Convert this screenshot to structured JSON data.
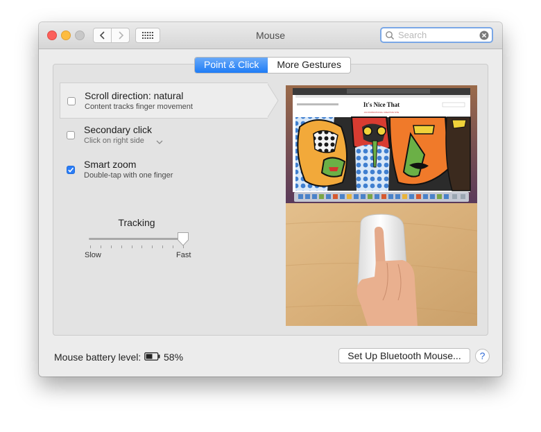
{
  "window": {
    "title": "Mouse"
  },
  "toolbar": {
    "search_placeholder": "Search"
  },
  "tabs": [
    {
      "label": "Point & Click",
      "active": true
    },
    {
      "label": "More Gestures",
      "active": false
    }
  ],
  "options": [
    {
      "title": "Scroll direction: natural",
      "subtitle": "Content tracks finger movement",
      "checked": false,
      "selected": true
    },
    {
      "title": "Secondary click",
      "subtitle": "Click on right side",
      "checked": false,
      "selected": false,
      "has_dropdown": true
    },
    {
      "title": "Smart zoom",
      "subtitle": "Double-tap with one finger",
      "checked": true,
      "selected": false
    }
  ],
  "tracking": {
    "label": "Tracking",
    "min_label": "Slow",
    "max_label": "Fast",
    "value_fraction": 1.0,
    "tick_count": 10
  },
  "preview": {
    "site_title": "It's Nice That",
    "browser_tab": "It's Nice That",
    "caption": "AN INSPIRATIONAL CREATIVE SITE"
  },
  "footer": {
    "battery_label": "Mouse battery level:",
    "battery_percent": "58%",
    "battery_level": 0.58,
    "setup_button": "Set Up Bluetooth Mouse...",
    "help_symbol": "?"
  },
  "colors": {
    "accent": "#1e7cf6",
    "close": "#fc605b",
    "minimize": "#fdbc40",
    "zoom": "#c8c8c8"
  }
}
